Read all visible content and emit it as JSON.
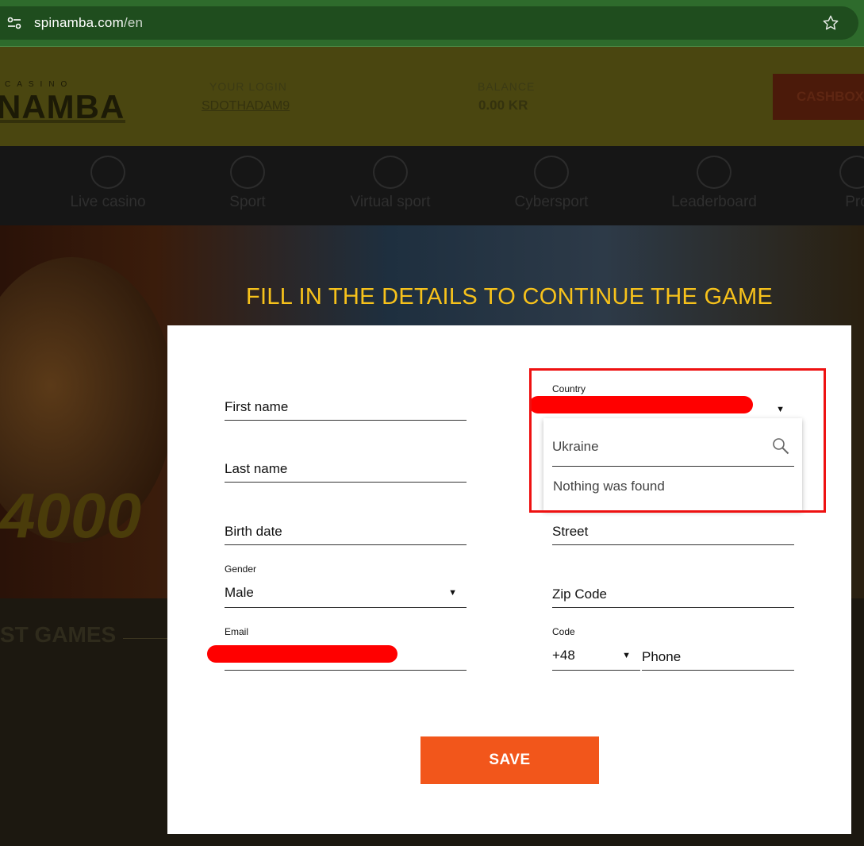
{
  "browser": {
    "url_host": "spinamba.com",
    "url_path": "/en"
  },
  "site": {
    "logo_small": "CASINO",
    "logo_main": "NAMBA",
    "login_label": "YOUR LOGIN",
    "login_value": "SDOTHADAM9",
    "balance_label": "BALANCE",
    "balance_value": "0.00 KR",
    "cashbox_label": "CASHBOX",
    "nav": [
      "Live casino",
      "Sport",
      "Virtual sport",
      "Cybersport",
      "Leaderboard",
      "Pro"
    ],
    "games_title": "ST GAMES",
    "banner_number": "4000"
  },
  "modal": {
    "title": "FILL IN THE DETAILS TO CONTINUE THE GAME",
    "fields": {
      "first_name": "First name",
      "last_name": "Last name",
      "birth_date": "Birth date",
      "gender_label": "Gender",
      "gender_value": "Male",
      "email_label": "Email",
      "country_label": "Country",
      "street": "Street",
      "zip_code": "Zip Code",
      "code_label": "Code",
      "code_value": "+48",
      "phone": "Phone"
    },
    "country_dropdown": {
      "search_value": "Ukraine",
      "empty_message": "Nothing was found"
    },
    "save_label": "SAVE"
  },
  "colors": {
    "title": "#f7c21b",
    "save_button": "#f2561b",
    "highlight": "#ee1111",
    "redaction": "#ff0000"
  }
}
